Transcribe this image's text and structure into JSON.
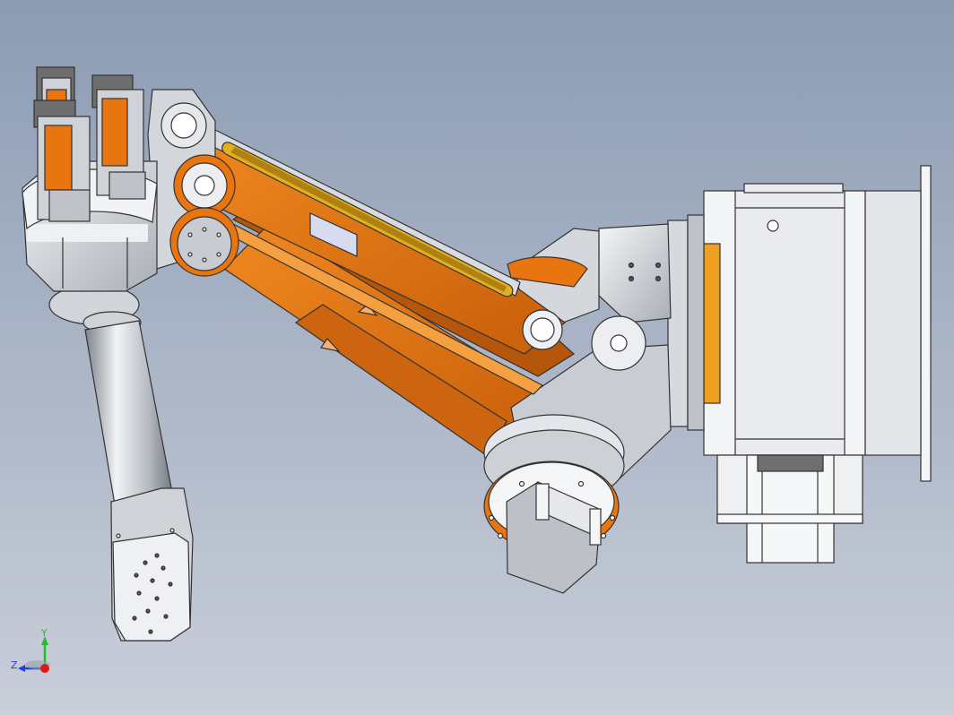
{
  "viewport": {
    "background_top": "#8c9cb4",
    "background_bottom": "#c9ced9"
  },
  "model": {
    "accent_color": "#e8750f",
    "accent_dark": "#b85608",
    "metal_light": "#eceef1",
    "metal_mid": "#c6cad0",
    "metal_dark": "#8a8f97",
    "edge_color": "#3a3a3a"
  },
  "triad": {
    "x_label": "",
    "y_label": "Y",
    "z_label": "Z",
    "y_color": "#1fbf2a",
    "z_color": "#1f3fd8",
    "origin_color": "#e01818"
  }
}
